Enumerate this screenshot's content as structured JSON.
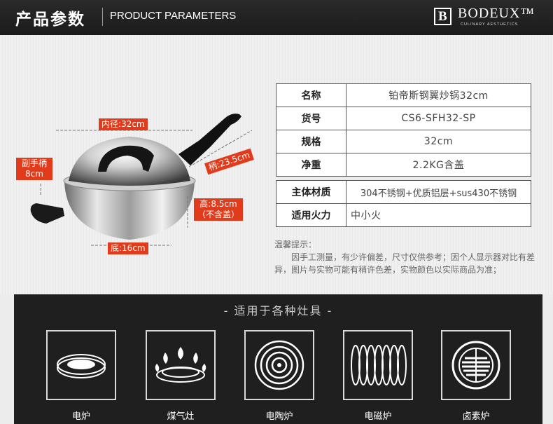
{
  "header": {
    "title_cn": "产品参数",
    "title_en": "PRODUCT PARAMETERS",
    "brand_mark": "B",
    "brand_name": "BODEUX™",
    "brand_tagline": "CULINARY AESTHETICS"
  },
  "dimensions": {
    "inner_diameter": "内径:32cm",
    "handle_length": "柄:23.5cm",
    "side_handle_line1": "副手柄",
    "side_handle_line2": "8cm",
    "height_line1": "高:8.5cm",
    "height_line2": "（不含盖）",
    "bottom_diameter": "底:16cm"
  },
  "specs": [
    {
      "key": "名称",
      "value": "铂帝斯钢翼炒锅32cm"
    },
    {
      "key": "货号",
      "value": "CS6-SFH32-SP"
    },
    {
      "key": "规格",
      "value": "32cm"
    },
    {
      "key": "净重",
      "value": "2.2KG含盖"
    },
    {
      "key": "主体材质",
      "value": "304不锈钢+优质铝层+sus430不锈钢"
    },
    {
      "key": "适用火力",
      "value": "中小火"
    }
  ],
  "note": {
    "title": "温馨提示：",
    "body": "因手工测量，有少许偏差，尺寸仅供参考；因个人显示器对比有差异，图片与实物可能有稍许色差，实物颜色以实际商品为准；"
  },
  "stoves": {
    "caption": "- 适用于各种灶具 -",
    "items": [
      {
        "icon": "electric-stove-icon",
        "label": "电炉"
      },
      {
        "icon": "gas-stove-icon",
        "label": "煤气灶"
      },
      {
        "icon": "ceramic-stove-icon",
        "label": "电陶炉"
      },
      {
        "icon": "induction-cooker-icon",
        "label": "电磁炉"
      },
      {
        "icon": "halogen-stove-icon",
        "label": "卤素炉"
      }
    ]
  },
  "colors": {
    "header_bg": "#1f1f1f",
    "label_red": "#e23b1c",
    "panel_bg": "#1f1f1f"
  }
}
